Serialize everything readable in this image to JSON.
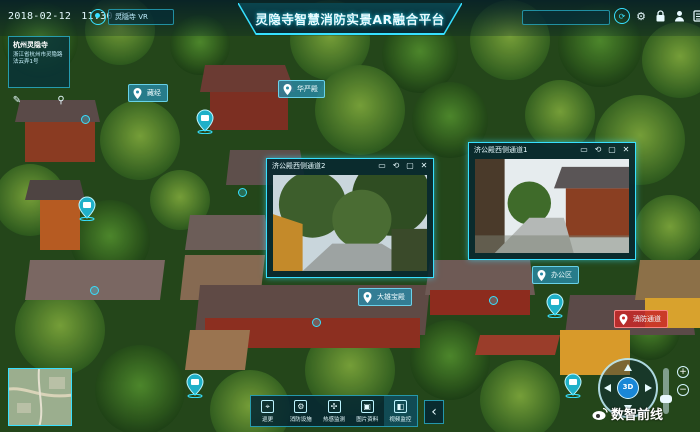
{
  "app": {
    "title": "灵隐寺智慧消防实景AR融合平台",
    "date": "2018-02-12",
    "time": "11:30:59",
    "location_field": "灵隐寺 VR",
    "accent_color": "#37e0ff",
    "alert_color": "#c82828"
  },
  "topbar_icons": [
    "settings-gear-icon",
    "lock-icon",
    "user-icon",
    "menu-icon"
  ],
  "info_card": {
    "title": "杭州灵隐寺",
    "body": "浙江省杭州市灵隐路法云弄1号"
  },
  "poi_labels": [
    {
      "name": "poi-label-1",
      "label": "藏经"
    },
    {
      "name": "poi-label-2",
      "label": "华严殿"
    },
    {
      "name": "poi-label-3",
      "label": "大雄宝殿"
    },
    {
      "name": "poi-label-4",
      "label": "办公区"
    },
    {
      "name": "poi-label-5",
      "label": "消防通道",
      "status": "alert"
    }
  ],
  "video_panels": [
    {
      "title": "济公殿西侧通道2"
    },
    {
      "title": "济公殿西侧通道1"
    }
  ],
  "toolbar": {
    "items": [
      {
        "label": "巡更",
        "icon": "patrol-icon"
      },
      {
        "label": "消防设施",
        "icon": "facility-icon"
      },
      {
        "label": "热感监测",
        "icon": "thermal-icon"
      },
      {
        "label": "图片资料",
        "icon": "image-icon"
      },
      {
        "label": "视频监控",
        "icon": "camera-icon",
        "active": true
      }
    ],
    "collapse": "‹"
  },
  "navigation": {
    "view_mode": "3D",
    "zoom_in": "+",
    "zoom_out": "−",
    "zoom_level": 0.3
  },
  "watermark": "数智前线"
}
